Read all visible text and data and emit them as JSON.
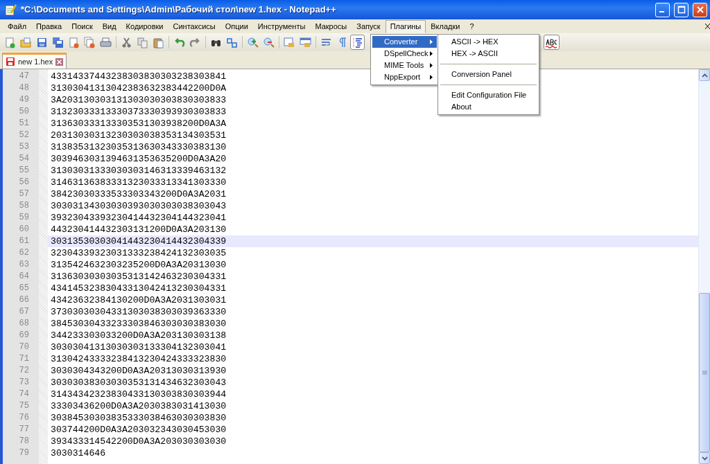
{
  "window": {
    "title": "*C:\\Documents and Settings\\Admin\\Рабочий стол\\new 1.hex - Notepad++"
  },
  "menu_bar": [
    {
      "label": "Файл",
      "selected": false
    },
    {
      "label": "Правка",
      "selected": false
    },
    {
      "label": "Поиск",
      "selected": false
    },
    {
      "label": "Вид",
      "selected": false
    },
    {
      "label": "Кодировки",
      "selected": false
    },
    {
      "label": "Синтаксисы",
      "selected": false
    },
    {
      "label": "Опции",
      "selected": false
    },
    {
      "label": "Инструменты",
      "selected": false
    },
    {
      "label": "Макросы",
      "selected": false
    },
    {
      "label": "Запуск",
      "selected": false
    },
    {
      "label": "Плагины",
      "selected": true
    },
    {
      "label": "Вкладки",
      "selected": false
    },
    {
      "label": "?",
      "selected": false
    }
  ],
  "toolbar": {
    "indent_guide_on": true,
    "spell_check_on": true
  },
  "plugins_menu": [
    {
      "label": "Converter",
      "selected": true
    },
    {
      "label": "DSpellCheck",
      "selected": false
    },
    {
      "label": "MIME Tools",
      "selected": false
    },
    {
      "label": "NppExport",
      "selected": false
    }
  ],
  "converter_submenu": [
    {
      "kind": "item",
      "label": "ASCII -> HEX"
    },
    {
      "kind": "item",
      "label": "HEX -> ASCII"
    },
    {
      "kind": "separator"
    },
    {
      "kind": "item",
      "label": "Conversion Panel"
    },
    {
      "kind": "separator"
    },
    {
      "kind": "item",
      "label": "Edit Configuration File"
    },
    {
      "kind": "item",
      "label": "About"
    }
  ],
  "tabs": [
    {
      "label": "new 1.hex",
      "selected": true,
      "modified": true
    }
  ],
  "editor": {
    "lines": [
      {
        "number": "47",
        "text": "43314337443238303830303238303841",
        "current": false
      },
      {
        "number": "48",
        "text": "31303041313042383632383442200D0A",
        "current": false
      },
      {
        "number": "49",
        "text": "3A203130303131303030303830303833",
        "current": false
      },
      {
        "number": "50",
        "text": "31323033313330373330393930303833",
        "current": false
      },
      {
        "number": "51",
        "text": "313630333133303531303938200D0A3A",
        "current": false
      },
      {
        "number": "52",
        "text": "20313030313230303038353134303531",
        "current": false
      },
      {
        "number": "53",
        "text": "31383531323035313630343330383130",
        "current": false
      },
      {
        "number": "54",
        "text": "3039463031394631353635200D0A3A20",
        "current": false
      },
      {
        "number": "55",
        "text": "31303031333030303146313339463132",
        "current": false
      },
      {
        "number": "56",
        "text": "31463136383331323033313341303330",
        "current": false
      },
      {
        "number": "57",
        "text": "38423030333533303343200D0A3A2031",
        "current": false
      },
      {
        "number": "58",
        "text": "30303134303030393030303038303043",
        "current": false
      },
      {
        "number": "59",
        "text": "39323043393230414432304144323041",
        "current": false
      },
      {
        "number": "60",
        "text": "443230414432303131200D0A3A203130",
        "current": false
      },
      {
        "number": "61",
        "text": "30313530303041443230414432304339",
        "current": true
      },
      {
        "number": "62",
        "text": "32304339323031333238424132303035",
        "current": false
      },
      {
        "number": "63",
        "text": "3135424632303235200D0A3A20313030",
        "current": false
      },
      {
        "number": "64",
        "text": "31363030303035313142463230304331",
        "current": false
      },
      {
        "number": "65",
        "text": "43414532383043313042413230304331",
        "current": false
      },
      {
        "number": "66",
        "text": "43423632384130200D0A3A2031303031",
        "current": false
      },
      {
        "number": "67",
        "text": "37303030304331303038303039363330",
        "current": false
      },
      {
        "number": "68",
        "text": "38453030433233303846303030383030",
        "current": false
      },
      {
        "number": "69",
        "text": "344233303033200D0A3A203130303138",
        "current": false
      },
      {
        "number": "70",
        "text": "30303041313030303133304132303041",
        "current": false
      },
      {
        "number": "71",
        "text": "31304243333238413230424333323830",
        "current": false
      },
      {
        "number": "72",
        "text": "3030304343200D0A3A20313030313930",
        "current": false
      },
      {
        "number": "73",
        "text": "30303038303030353131434632303043",
        "current": false
      },
      {
        "number": "74",
        "text": "31434342323830433130303830303944",
        "current": false
      },
      {
        "number": "75",
        "text": "33303436200D0A3A2030383031413030",
        "current": false
      },
      {
        "number": "76",
        "text": "30384530303835333038463030303830",
        "current": false
      },
      {
        "number": "77",
        "text": "303744200D0A3A203032343030453030",
        "current": false
      },
      {
        "number": "78",
        "text": "393433314542200D0A3A203030303030",
        "current": false
      },
      {
        "number": "79",
        "text": "3030314646",
        "current": false
      }
    ]
  }
}
